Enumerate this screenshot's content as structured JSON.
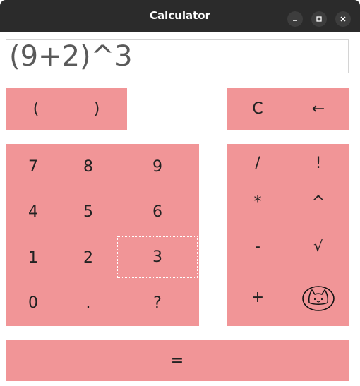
{
  "window": {
    "title": "Calculator"
  },
  "display": {
    "value": "(9+2)^3"
  },
  "paren_keys": [
    "(",
    ")"
  ],
  "control_keys": [
    "C",
    "←"
  ],
  "numpad_keys": [
    "7",
    "8",
    "9",
    "4",
    "5",
    "6",
    "1",
    "2",
    "3",
    "0",
    ".",
    "?"
  ],
  "operator_keys": [
    "/",
    "!",
    "*",
    "^",
    "-",
    "√",
    "+"
  ],
  "equals_key": "=",
  "colors": {
    "key_bg": "#f19597",
    "titlebar": "#2b2b2b"
  }
}
